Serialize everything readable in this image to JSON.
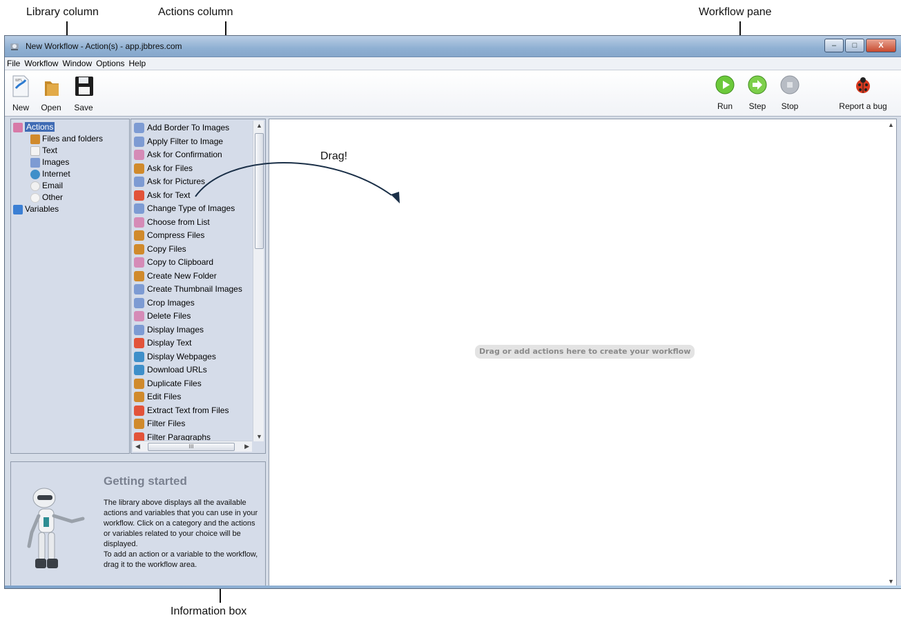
{
  "callouts": {
    "library": "Library column",
    "actions": "Actions column",
    "workflow": "Workflow pane",
    "info": "Information box",
    "drag": "Drag!"
  },
  "window": {
    "title": "New Workflow - Action(s) - app.jbbres.com",
    "buttons": {
      "minimize": "–",
      "maximize": "□",
      "close": "X"
    }
  },
  "menu": [
    "File",
    "Workflow",
    "Window",
    "Options",
    "Help"
  ],
  "toolbar": {
    "new": "New",
    "open": "Open",
    "save": "Save",
    "run": "Run",
    "step": "Step",
    "stop": "Stop",
    "report": "Report a bug"
  },
  "library": {
    "actions": "Actions",
    "children": [
      "Files and folders",
      "Text",
      "Images",
      "Internet",
      "Email",
      "Other"
    ],
    "variables": "Variables"
  },
  "actions": [
    "Add Border To Images",
    "Apply Filter to Image",
    "Ask for Confirmation",
    "Ask for Files",
    "Ask for Pictures",
    "Ask for Text",
    "Change Type of Images",
    "Choose from List",
    "Compress Files",
    "Copy Files",
    "Copy to Clipboard",
    "Create New Folder",
    "Create Thumbnail Images",
    "Crop Images",
    "Delete Files",
    "Display Images",
    "Display Text",
    "Display Webpages",
    "Download URLs",
    "Duplicate Files",
    "Edit Files",
    "Extract Text from Files",
    "Filter Files",
    "Filter Paragraphs"
  ],
  "action_icon_colors": [
    "#7d9bd3",
    "#7d9bd3",
    "#d58bb7",
    "#d08a2c",
    "#7d9bd3",
    "#e2533a",
    "#7d9bd3",
    "#d58bb7",
    "#d08a2c",
    "#d08a2c",
    "#d58bb7",
    "#d08a2c",
    "#7d9bd3",
    "#7d9bd3",
    "#d58bb7",
    "#7d9bd3",
    "#e2533a",
    "#3f8fc9",
    "#3f8fc9",
    "#d08a2c",
    "#d08a2c",
    "#e2533a",
    "#d08a2c",
    "#e2533a"
  ],
  "hscroll_mark": "III",
  "info": {
    "title": "Getting started",
    "text": "The library above displays all the available actions and variables that you can use in your workflow. Click on a category and the actions or variables related to your choice will be displayed.\nTo add an action or a variable to the workflow, drag it to the workflow area."
  },
  "workflow": {
    "placeholder": "Drag or add actions here to create your workflow"
  }
}
